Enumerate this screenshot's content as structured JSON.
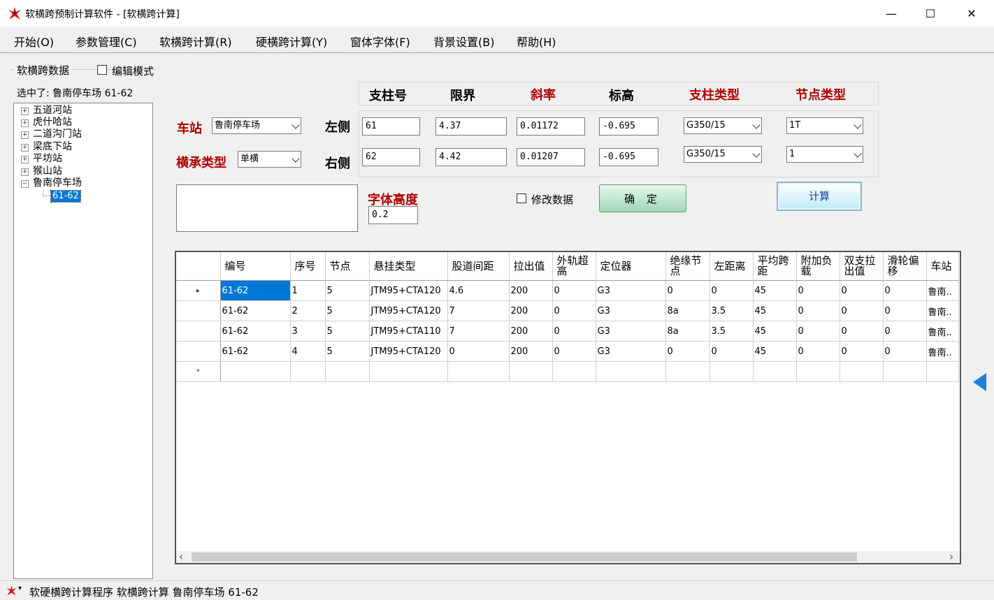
{
  "window": {
    "title": "软横跨预制计算软件 - [软横跨计算]",
    "minimize": "—",
    "maximize": "☐",
    "close": "✕"
  },
  "menu": [
    "开始(O)",
    "参数管理(C)",
    "软横跨计算(R)",
    "硬横跨计算(Y)",
    "窗体字体(F)",
    "背景设置(B)",
    "帮助(H)"
  ],
  "left": {
    "group_title": "软横跨数据",
    "edit_mode_label": "编辑模式",
    "selected_text": "选中了: 鲁南停车场 61-62",
    "tree": [
      {
        "label": "五道河站",
        "expander": "+"
      },
      {
        "label": "虎什哈站",
        "expander": "+"
      },
      {
        "label": "二道沟门站",
        "expander": "+"
      },
      {
        "label": "梁底下站",
        "expander": "+"
      },
      {
        "label": "平坊站",
        "expander": "+"
      },
      {
        "label": "猴山站",
        "expander": "+"
      },
      {
        "label": "鲁南停车场",
        "expander": "−"
      }
    ],
    "tree_child": "61-62"
  },
  "form": {
    "station_label": "车站",
    "station_value": "鲁南停车场",
    "bearing_label": "横承类型",
    "bearing_value": "单横",
    "left_label": "左侧",
    "right_label": "右侧",
    "headers": {
      "pole_no": "支柱号",
      "limit": "限界",
      "slope": "斜率",
      "elevation": "标高",
      "pole_type": "支柱类型",
      "node_type": "节点类型"
    },
    "left_row": {
      "pole_no": "61",
      "limit": "4.37",
      "slope": "0.01172",
      "elevation": "-0.695",
      "pole_type": "G350/15",
      "node_type": "1T"
    },
    "right_row": {
      "pole_no": "62",
      "limit": "4.42",
      "slope": "0.01207",
      "elevation": "-0.695",
      "pole_type": "G350/15",
      "node_type": "1"
    },
    "font_height_label": "字体高度",
    "font_height_value": "0.2",
    "modify_label": "修改数据",
    "confirm_label": "确 定",
    "calc_label": "计算"
  },
  "grid": {
    "columns": [
      "编号",
      "序号",
      "节点",
      "悬挂类型",
      "股道间距",
      "拉出值",
      "外轨超高",
      "定位器",
      "绝缘节点",
      "左距离",
      "平均跨距",
      "附加负载",
      "双支拉出值",
      "滑轮偏移",
      "车站"
    ],
    "rows": [
      [
        "61-62",
        "1",
        "5",
        "JTM95+CTA120",
        "4.6",
        "200",
        "0",
        "G3",
        "0",
        "0",
        "45",
        "0",
        "0",
        "0",
        "鲁南.."
      ],
      [
        "61-62",
        "2",
        "5",
        "JTM95+CTA120",
        "7",
        "200",
        "0",
        "G3",
        "8a",
        "3.5",
        "45",
        "0",
        "0",
        "0",
        "鲁南.."
      ],
      [
        "61-62",
        "3",
        "5",
        "JTM95+CTA110",
        "7",
        "200",
        "0",
        "G3",
        "8a",
        "3.5",
        "45",
        "0",
        "0",
        "0",
        "鲁南.."
      ],
      [
        "61-62",
        "4",
        "5",
        "JTM95+CTA120",
        "0",
        "200",
        "0",
        "G3",
        "0",
        "0",
        "45",
        "0",
        "0",
        "0",
        "鲁南.."
      ]
    ],
    "current_row_marker": "▸",
    "new_row_marker": "*",
    "scroll_left": "‹",
    "scroll_right": "›"
  },
  "status": {
    "text": "软硬横跨计算程序  软横跨计算  鲁南停车场 61-62",
    "menu_caret": "▾"
  }
}
